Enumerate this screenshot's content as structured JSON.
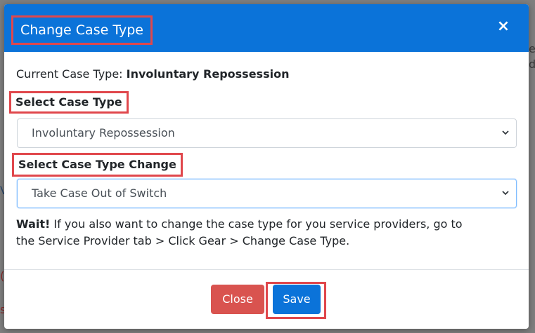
{
  "background": {
    "fragments": [
      "e",
      "d",
      "V",
      "(",
      "s"
    ]
  },
  "modal": {
    "title": "Change Case Type",
    "close_icon": "×",
    "current_case": {
      "label": "Current Case Type:",
      "value": "Involuntary Repossession"
    },
    "select_case_type": {
      "label": "Select Case Type",
      "value": "Involuntary Repossession"
    },
    "select_case_type_change": {
      "label": "Select Case Type Change",
      "value": "Take Case Out of Switch"
    },
    "warning": {
      "lead": "Wait!",
      "text": " If you also want to change the case type for you service providers, go to the Service Provider tab > Click Gear > Change Case Type."
    },
    "footer": {
      "close_label": "Close",
      "save_label": "Save"
    }
  },
  "colors": {
    "header": "#0b73d9",
    "highlight": "#e0474c",
    "close_button": "#d9534f",
    "save_button": "#0b73d9"
  }
}
